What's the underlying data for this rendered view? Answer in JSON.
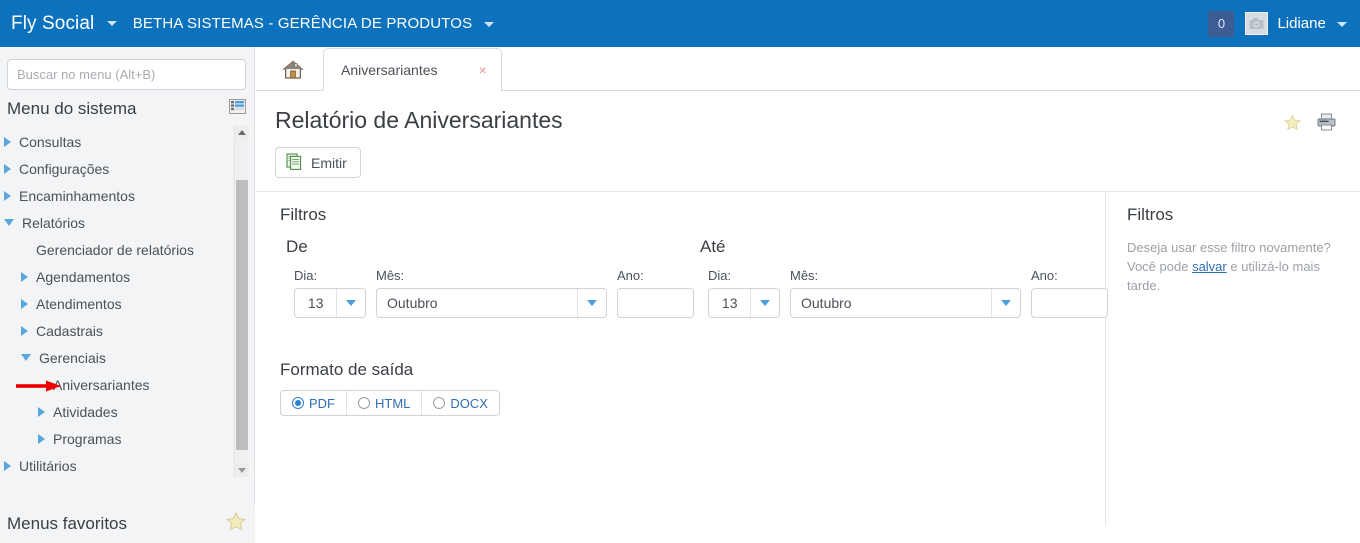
{
  "topbar": {
    "brand": "Fly Social",
    "org": "BETHA SISTEMAS - GERÊNCIA DE PRODUTOS",
    "notification_count": "0",
    "username": "Lidiane",
    "background_color": "#0c72bd"
  },
  "sidebar": {
    "search_placeholder": "Buscar no menu (Alt+B)",
    "search_value": "",
    "menu_title": "Menu do sistema",
    "favorites_title": "Menus favoritos",
    "items": [
      {
        "label": "Consultas",
        "level": 0,
        "state": "collapsed"
      },
      {
        "label": "Configurações",
        "level": 0,
        "state": "collapsed"
      },
      {
        "label": "Encaminhamentos",
        "level": 0,
        "state": "collapsed"
      },
      {
        "label": "Relatórios",
        "level": 0,
        "state": "expanded"
      },
      {
        "label": "Gerenciador de relatórios",
        "level": 1,
        "state": "leaf"
      },
      {
        "label": "Agendamentos",
        "level": 1,
        "state": "collapsed"
      },
      {
        "label": "Atendimentos",
        "level": 1,
        "state": "collapsed"
      },
      {
        "label": "Cadastrais",
        "level": 1,
        "state": "collapsed"
      },
      {
        "label": "Gerenciais",
        "level": 1,
        "state": "expanded"
      },
      {
        "label": "Aniversariantes",
        "level": 2,
        "state": "leaf",
        "annotated": true
      },
      {
        "label": "Atividades",
        "level": 2,
        "state": "collapsed"
      },
      {
        "label": "Programas",
        "level": 2,
        "state": "collapsed"
      },
      {
        "label": "Utilitários",
        "level": 0,
        "state": "collapsed"
      }
    ]
  },
  "tabs": [
    {
      "label": "",
      "icon": "home-icon",
      "active": false
    },
    {
      "label": "Aniversariantes",
      "icon": "",
      "active": true,
      "close": "×"
    }
  ],
  "page": {
    "title": "Relatório de Aniversariantes",
    "emit_button": "Emitir"
  },
  "filters": {
    "section_title": "Filtros",
    "from": {
      "group_title": "De",
      "day_label": "Dia:",
      "day_value": "13",
      "month_label": "Mês:",
      "month_value": "Outubro",
      "year_label": "Ano:",
      "year_value": ""
    },
    "to": {
      "group_title": "Até",
      "day_label": "Dia:",
      "day_value": "13",
      "month_label": "Mês:",
      "month_value": "Outubro",
      "year_label": "Ano:",
      "year_value": ""
    }
  },
  "output_format": {
    "title": "Formato de saída",
    "options": [
      {
        "label": "PDF",
        "selected": true
      },
      {
        "label": "HTML",
        "selected": false
      },
      {
        "label": "DOCX",
        "selected": false
      }
    ]
  },
  "side_panel": {
    "title": "Filtros",
    "note_before": "Deseja usar esse filtro novamente? Você pode ",
    "note_link": "salvar",
    "note_after": " e utilizá-lo mais tarde."
  }
}
